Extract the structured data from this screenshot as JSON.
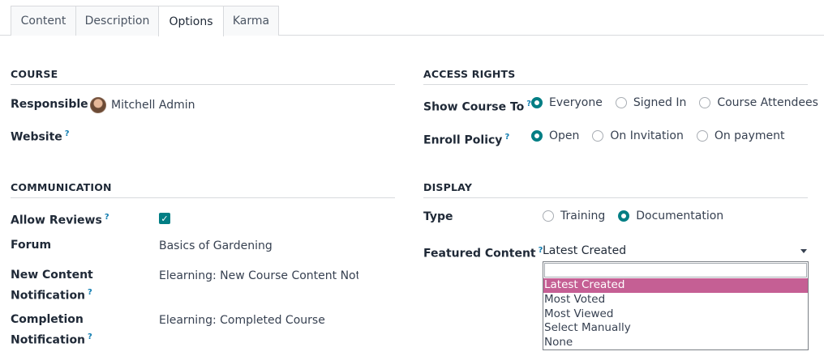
{
  "tabs": [
    {
      "label": "Content"
    },
    {
      "label": "Description"
    },
    {
      "label": "Options"
    },
    {
      "label": "Karma"
    }
  ],
  "course": {
    "section_title": "COURSE",
    "responsible_label": "Responsible",
    "responsible_value": "Mitchell Admin",
    "website_label": "Website",
    "help_mark": "?"
  },
  "communication": {
    "section_title": "COMMUNICATION",
    "allow_reviews_label": "Allow Reviews",
    "allow_reviews_checked": true,
    "forum_label": "Forum",
    "forum_value": "Basics of Gardening",
    "new_content_label_1": "New Content",
    "new_content_label_2": "Notification",
    "new_content_value": "Elearning: New Course Content Notification",
    "completion_label_1": "Completion",
    "completion_label_2": "Notification",
    "completion_value": "Elearning: Completed Course"
  },
  "access_rights": {
    "section_title": "ACCESS RIGHTS",
    "show_course_label": "Show Course To",
    "show_course_options": [
      "Everyone",
      "Signed In",
      "Course Attendees"
    ],
    "show_course_selected": "Everyone",
    "enroll_label": "Enroll Policy",
    "enroll_options": [
      "Open",
      "On Invitation",
      "On payment"
    ],
    "enroll_selected": "Open"
  },
  "display": {
    "section_title": "DISPLAY",
    "type_label": "Type",
    "type_options": [
      "Training",
      "Documentation"
    ],
    "type_selected": "Documentation",
    "featured_label": "Featured Content",
    "featured_value": "Latest Created",
    "featured_search_value": "",
    "featured_options": [
      "Latest Created",
      "Most Voted",
      "Most Viewed",
      "Select Manually",
      "None"
    ]
  },
  "colors": {
    "accent": "#017e84",
    "highlight": "#c55f94",
    "help": "#0f7cb0"
  }
}
